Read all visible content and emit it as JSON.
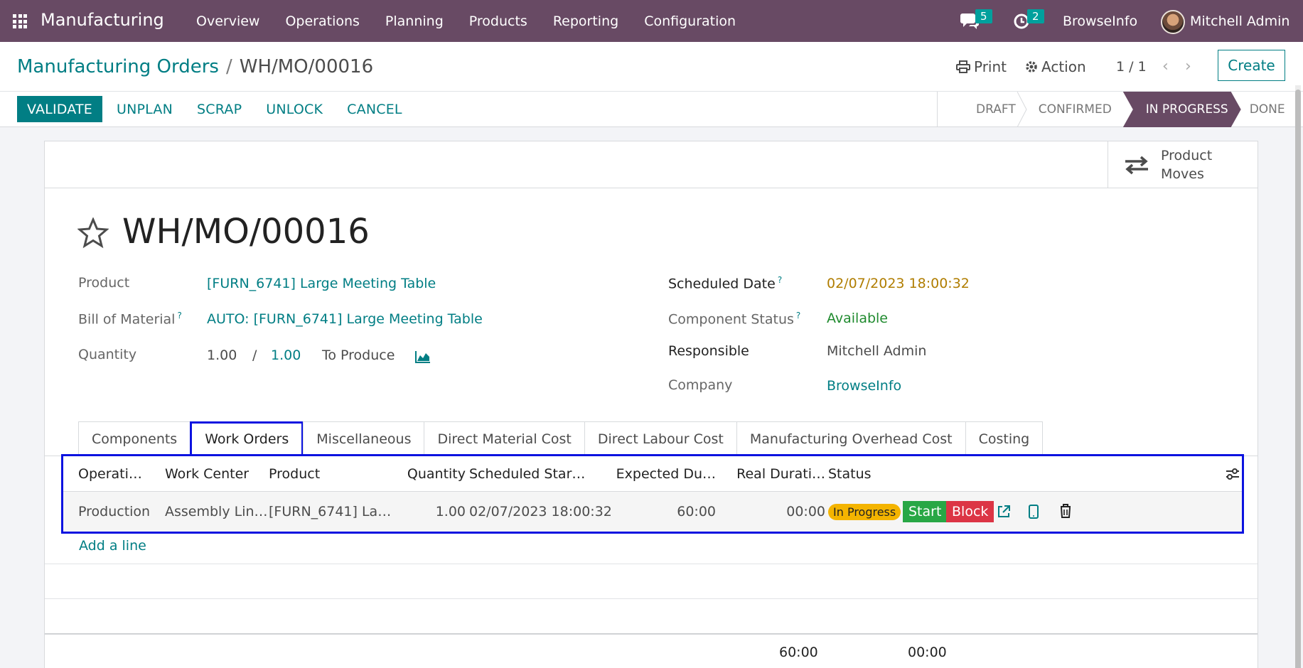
{
  "nav": {
    "app_name": "Manufacturing",
    "menu": [
      "Overview",
      "Operations",
      "Planning",
      "Products",
      "Reporting",
      "Configuration"
    ],
    "messages_count": "5",
    "activities_count": "2",
    "company": "BrowseInfo",
    "user": "Mitchell Admin"
  },
  "control": {
    "breadcrumb_parent": "Manufacturing Orders",
    "breadcrumb_sep": "/",
    "breadcrumb_current": "WH/MO/00016",
    "print_label": "Print",
    "action_label": "Action",
    "pager": "1 / 1",
    "create_label": "Create"
  },
  "actions": [
    "VALIDATE",
    "UNPLAN",
    "SCRAP",
    "UNLOCK",
    "CANCEL"
  ],
  "stages": [
    {
      "label": "DRAFT",
      "active": false
    },
    {
      "label": "CONFIRMED",
      "active": false
    },
    {
      "label": "IN PROGRESS",
      "active": true
    },
    {
      "label": "DONE",
      "active": false
    }
  ],
  "smart_button": {
    "line1": "Product",
    "line2": "Moves"
  },
  "record": {
    "title": "WH/MO/00016",
    "product_label": "Product",
    "product": "[FURN_6741] Large Meeting Table",
    "bom_label": "Bill of Material",
    "bom": "AUTO: [FURN_6741] Large Meeting Table",
    "qty_label": "Quantity",
    "qty_done": "1.00",
    "qty_sep": "/",
    "qty_total": "1.00",
    "qty_suffix": "To Produce",
    "scheduled_label": "Scheduled Date",
    "scheduled": "02/07/2023 18:00:32",
    "component_label": "Component Status",
    "component": "Available",
    "responsible_label": "Responsible",
    "responsible": "Mitchell Admin",
    "company_label": "Company",
    "company": "BrowseInfo",
    "help_mark": "?"
  },
  "tabs": [
    {
      "label": "Components",
      "active": false
    },
    {
      "label": "Work Orders",
      "active": true
    },
    {
      "label": "Miscellaneous",
      "active": false
    },
    {
      "label": "Direct Material Cost",
      "active": false
    },
    {
      "label": "Direct Labour Cost",
      "active": false
    },
    {
      "label": "Manufacturing Overhead Cost",
      "active": false
    },
    {
      "label": "Costing",
      "active": false
    }
  ],
  "work_orders": {
    "columns": [
      "Operati…",
      "Work Center",
      "Product",
      "Quantity",
      "Scheduled Star…",
      "Expected Du…",
      "Real Durati…",
      "Status"
    ],
    "rows": [
      {
        "operation": "Production",
        "work_center": "Assembly Lin…",
        "product": "[FURN_6741] La…",
        "quantity": "1.00",
        "scheduled": "02/07/2023 18:00:32",
        "expected": "60:00",
        "real": "00:00",
        "status": "In Progress",
        "start": "Start",
        "block": "Block"
      }
    ],
    "add_line": "Add a line",
    "total_expected": "60:00",
    "total_real": "00:00"
  },
  "colors": {
    "brand": "#684a64",
    "accent": "#017e84",
    "highlight": "#0c13e0",
    "status_pill": "#f4b400",
    "start": "#28a745",
    "block": "#dc3545"
  }
}
